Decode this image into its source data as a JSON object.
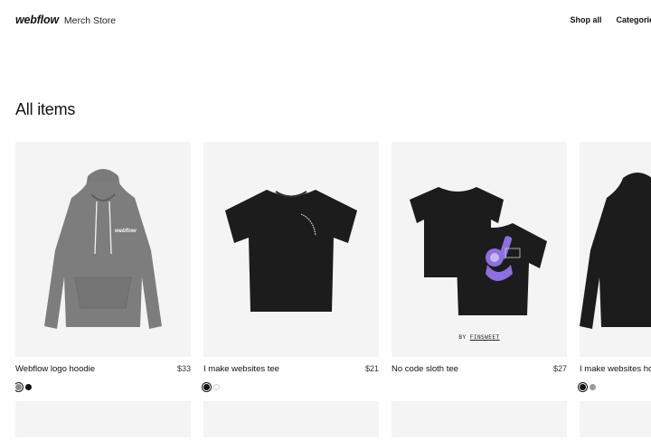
{
  "header": {
    "logo_word": "webflow",
    "store_name": "Merch Store",
    "nav": [
      "Shop all",
      "Categories"
    ]
  },
  "page_title": "All items",
  "products": [
    {
      "title": "Webflow logo hoodie",
      "price": "$33",
      "swatches": [
        "#8a8a8a",
        "#111111"
      ],
      "selected": 0,
      "print_text": "webflow"
    },
    {
      "title": "I make websites tee",
      "price": "$21",
      "swatches": [
        "#111111",
        "#ffffff"
      ],
      "selected": 0
    },
    {
      "title": "No code sloth tee",
      "price": "$27",
      "swatches": [],
      "credit_prefix": "BY",
      "credit_brand": "FINSWEET"
    },
    {
      "title": "I make websites ho",
      "price": "",
      "swatches": [
        "#111111",
        "#9a9a9a"
      ],
      "selected": 0
    }
  ],
  "colors": {
    "card_bg": "#f4f4f4",
    "garment_black": "#1c1c1c",
    "hoodie_gray": "#7c7c7c",
    "sloth_purple": "#8c6fe0"
  }
}
